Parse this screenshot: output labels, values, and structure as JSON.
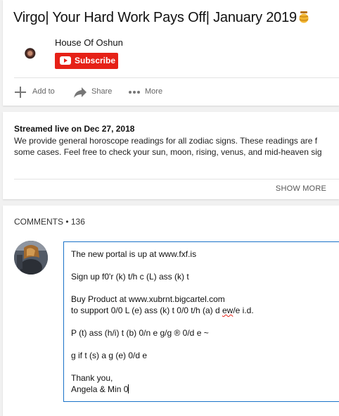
{
  "video": {
    "title": "Virgo| Your Hard Work Pays Off| January 2019"
  },
  "channel": {
    "name": "House Of Oshun",
    "subscribe_label": "Subscribe"
  },
  "actions": {
    "add_to": "Add to",
    "share": "Share",
    "more": "More"
  },
  "description": {
    "streamed": "Streamed live on Dec 27, 2018",
    "line1": "We provide general horoscope readings for all zodiac signs. These readings are f",
    "line2": "some cases. Feel free to check your sun, moon, rising, venus, and mid-heaven sig",
    "show_more": "SHOW MORE"
  },
  "comments": {
    "label": "COMMENTS",
    "separator": " • ",
    "count": "136",
    "draft": {
      "line1": "The new portal is up at www.fxf.is",
      "line2": "Sign up f0'r (k) t/h c (L) ass (k) t",
      "line3": "Buy Product at www.xubrnt.bigcartel.com",
      "line4_start": "to support 0/0 L (e) ass (k) t 0/0 t/h (a) d ",
      "line4_typo": "ew",
      "line4_end": "/e i.d.",
      "line5": "P (t) ass (h/i) t (b) 0/n e g/g ® 0/d e ~",
      "line6": "g if t (s) a g (e) 0/d e",
      "line7": "Thank you,",
      "line8": "Angela & Min 0"
    }
  },
  "colors": {
    "subscribe_red": "#e62117",
    "focus_blue": "#1a73c9"
  },
  "icons": {
    "emoji": "honey-pot-icon",
    "add": "plus-icon",
    "share": "share-arrow-icon",
    "more": "more-dots-icon",
    "subscribe": "youtube-logo-icon"
  }
}
